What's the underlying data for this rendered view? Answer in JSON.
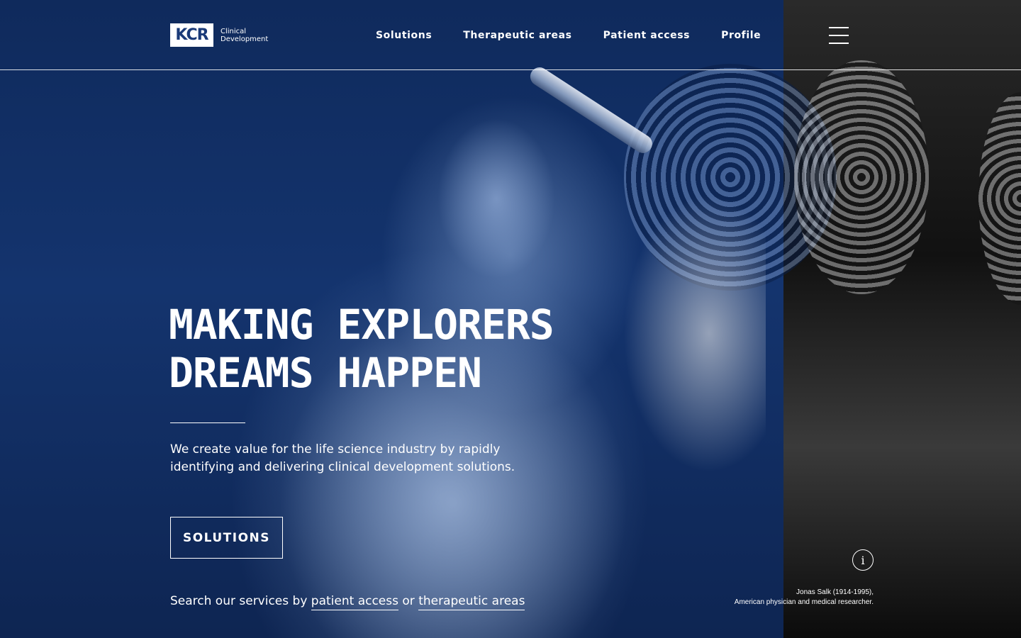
{
  "logo": {
    "mark": "KCR",
    "line1": "Clinical",
    "line2": "Development"
  },
  "nav": {
    "items": [
      {
        "label": "Solutions"
      },
      {
        "label": "Therapeutic areas"
      },
      {
        "label": "Patient access"
      },
      {
        "label": "Profile"
      }
    ]
  },
  "hero": {
    "headline_line1": "MAKING EXPLORERS",
    "headline_line2": "DREAMS HAPPEN",
    "lead_line1": "We create value for the life science industry by rapidly",
    "lead_line2": "identifying and delivering clinical development solutions.",
    "cta_label": "SOLUTIONS",
    "search_prefix": "Search our services by",
    "search_link1": "patient access",
    "search_or": "or",
    "search_link2": "therapeutic areas"
  },
  "photo_caption": {
    "line1": "Jonas Salk (1914-1995),",
    "line2": "American physician and medical researcher.",
    "info_icon_glyph": "i"
  },
  "colors": {
    "hero_blue": "#14346e",
    "text": "#ffffff"
  }
}
